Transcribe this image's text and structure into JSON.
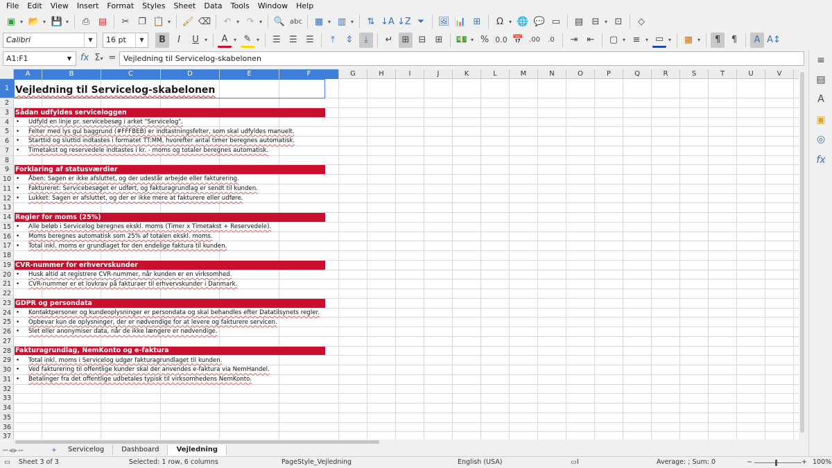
{
  "menu": [
    "File",
    "Edit",
    "View",
    "Insert",
    "Format",
    "Styles",
    "Sheet",
    "Data",
    "Tools",
    "Window",
    "Help"
  ],
  "font": {
    "name": "Calibri",
    "size": "16 pt"
  },
  "name_box": "A1:F1",
  "formula_input": "Vejledning til Servicelog-skabelonen",
  "columns": [
    "A",
    "B",
    "C",
    "D",
    "E",
    "F",
    "G",
    "H",
    "I",
    "J",
    "K",
    "L",
    "M",
    "N",
    "O",
    "P",
    "Q",
    "R",
    "S",
    "T",
    "U",
    "V",
    "W"
  ],
  "rows": [
    "1",
    "2",
    "3",
    "4",
    "5",
    "6",
    "7",
    "8",
    "9",
    "10",
    "11",
    "12",
    "13",
    "14",
    "15",
    "16",
    "17",
    "18",
    "19",
    "20",
    "21",
    "22",
    "23",
    "24",
    "25",
    "26",
    "27",
    "28",
    "29",
    "30",
    "31",
    "32",
    "33",
    "34",
    "35",
    "36",
    "37"
  ],
  "sheet": {
    "title": "Vejledning til Servicelog-skabelonen",
    "sections": [
      {
        "row": 3,
        "heading": "Sådan udfyldes serviceloggen",
        "items": [
          "Udfyld en linje pr. servicebesøg i arket \"Servicelog\".",
          "Felter med lys gul baggrund (#FFFBEB) er indtastningsfelter, som skal udfyldes manuelt.",
          "Starttid og sluttid indtastes i formatet TT:MM, hvorefter antal timer beregnes automatisk.",
          "Timetakst og reservedele indtastes i kr. - moms og totaler beregnes automatisk."
        ]
      },
      {
        "row": 9,
        "heading": "Forklaring af statusværdier",
        "items": [
          "Åben: Sagen er ikke afsluttet, og der udestår arbejde eller fakturering.",
          "Faktureret: Servicebesøget er udført, og fakturagrundlag er sendt til kunden.",
          "Lukket: Sagen er afsluttet, og der er ikke mere at fakturere eller udføre."
        ]
      },
      {
        "row": 14,
        "heading": "Regler for moms (25%)",
        "items": [
          "Alle beløb i Servicelog beregnes ekskl. moms (Timer x Timetakst + Reservedele).",
          "Moms beregnes automatisk som 25% af totalen ekskl. moms.",
          "Total inkl. moms er grundlaget for den endelige faktura til kunden."
        ]
      },
      {
        "row": 19,
        "heading": "CVR-nummer for erhvervskunder",
        "items": [
          "Husk altid at registrere CVR-nummer, når kunden er en virksomhed.",
          "CVR-nummer er et lovkrav på fakturaer til erhvervskunder i Danmark."
        ]
      },
      {
        "row": 23,
        "heading": "GDPR og persondata",
        "items": [
          "Kontaktpersoner og kundeoplysninger er persondata og skal behandles efter Datatilsynets regler.",
          "Opbevar kun de oplysninger, der er nødvendige for at levere og fakturere servicen.",
          "Slet eller anonymiser data, når de ikke længere er nødvendige."
        ]
      },
      {
        "row": 28,
        "heading": "Fakturagrundlag, NemKonto og e-faktura",
        "items": [
          "Total inkl. moms i Servicelog udgør fakturagrundlaget til kunden.",
          "Ved fakturering til offentlige kunder skal der anvendes e-faktura via NemHandel.",
          "Betalinger fra det offentlige udbetales typisk til virksomhedens NemKonto."
        ]
      }
    ],
    "bullet": "•"
  },
  "tabs": [
    "Servicelog",
    "Dashboard",
    "Vejledning"
  ],
  "active_tab": "Vejledning",
  "status": {
    "sheet": "Sheet 3 of 3",
    "selection": "Selected: 1 row, 6 columns",
    "page_style": "PageStyle_Vejledning",
    "language": "English (USA)",
    "sum": "Average: ; Sum: 0",
    "zoom": "100%"
  },
  "colors": {
    "section_bg": "#C8102E",
    "selection": "#3F7FD9"
  }
}
